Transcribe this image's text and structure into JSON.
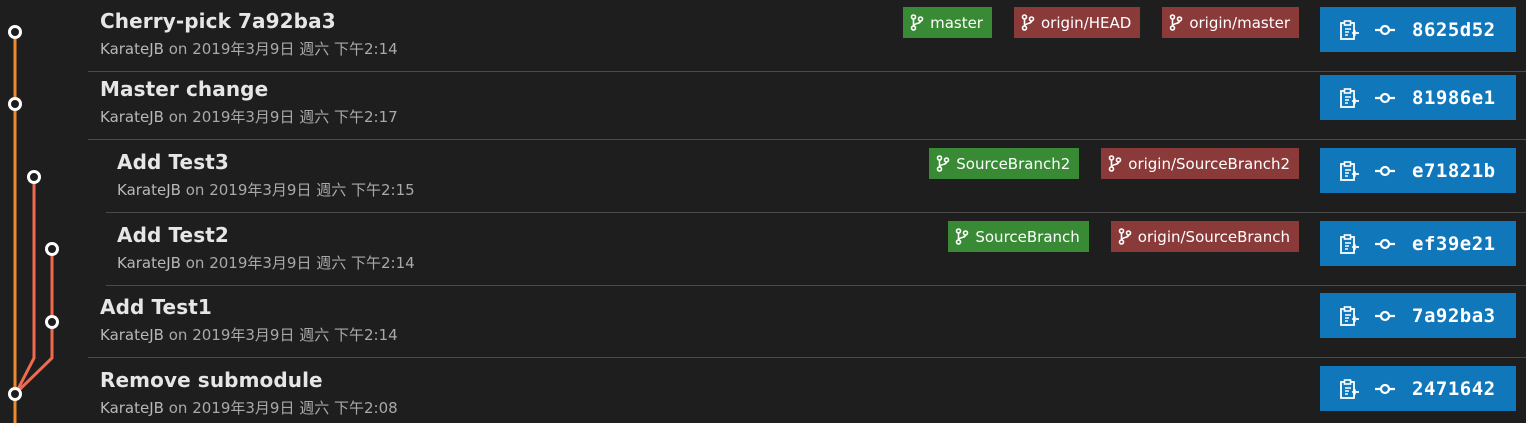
{
  "commits": [
    {
      "title": "Cherry-pick 7a92ba3",
      "author": "KarateJB",
      "on": "on",
      "date": "2019年3月9日 週六 下午2:14",
      "hash": "8625d52",
      "refs": [
        {
          "label": "master",
          "kind": "local"
        },
        {
          "label": "origin/HEAD",
          "kind": "remote"
        },
        {
          "label": "origin/master",
          "kind": "remote"
        }
      ]
    },
    {
      "title": "Master change",
      "author": "KarateJB",
      "on": "on",
      "date": "2019年3月9日 週六 下午2:17",
      "hash": "81986e1",
      "refs": []
    },
    {
      "title": "Add Test3",
      "author": "KarateJB",
      "on": "on",
      "date": "2019年3月9日 週六 下午2:15",
      "hash": "e71821b",
      "refs": [
        {
          "label": "SourceBranch2",
          "kind": "local"
        },
        {
          "label": "origin/SourceBranch2",
          "kind": "remote"
        }
      ]
    },
    {
      "title": "Add Test2",
      "author": "KarateJB",
      "on": "on",
      "date": "2019年3月9日 週六 下午2:14",
      "hash": "ef39e21",
      "refs": [
        {
          "label": "SourceBranch",
          "kind": "local"
        },
        {
          "label": "origin/SourceBranch",
          "kind": "remote"
        }
      ]
    },
    {
      "title": "Add Test1",
      "author": "KarateJB",
      "on": "on",
      "date": "2019年3月9日 週六 下午2:14",
      "hash": "7a92ba3",
      "refs": []
    },
    {
      "title": "Remove submodule",
      "author": "KarateJB",
      "on": "on",
      "date": "2019年3月9日 週六 下午2:08",
      "hash": "2471642",
      "refs": []
    }
  ],
  "colors": {
    "background": "#1e1e1e",
    "local_branch": "#388a34",
    "remote_branch": "#8b3a3a",
    "hash_button": "#1177bb",
    "graph_main": "#f0892e",
    "graph_branch": "#ef6b4f"
  },
  "icons": {
    "branch": "git-branch-icon",
    "copy": "copy-clipboard-icon",
    "commit": "git-commit-icon"
  }
}
